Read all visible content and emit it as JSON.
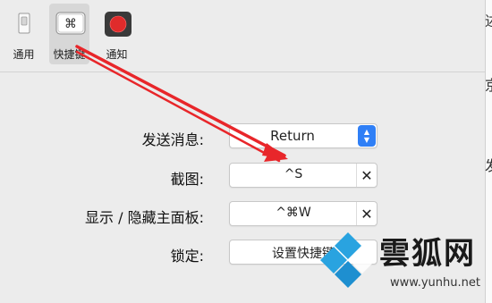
{
  "toolbar": {
    "tabs": [
      {
        "label": "通用",
        "icon": "general-switch-icon"
      },
      {
        "label": "快捷键",
        "icon": "command-key-icon",
        "glyph": "⌘"
      },
      {
        "label": "通知",
        "icon": "record-icon"
      }
    ],
    "selected": "快捷键"
  },
  "rows": {
    "send": {
      "label": "发送消息:",
      "value": "Return"
    },
    "screenshot": {
      "label": "截图:",
      "value": "^S",
      "clear": "✕"
    },
    "toggle": {
      "label": "显示 / 隐藏主面板:",
      "value": "^⌘W",
      "clear": "✕"
    },
    "lock": {
      "label": "锁定:",
      "value": "设置快捷键"
    }
  },
  "right_edge_chars": [
    "述",
    "京",
    "发"
  ],
  "watermark": {
    "brand": "雲狐网",
    "url": "www.yunhu.net"
  },
  "colors": {
    "accent": "#2f7ff6",
    "annotation": "#e8262a",
    "record": "#e02b2b"
  }
}
